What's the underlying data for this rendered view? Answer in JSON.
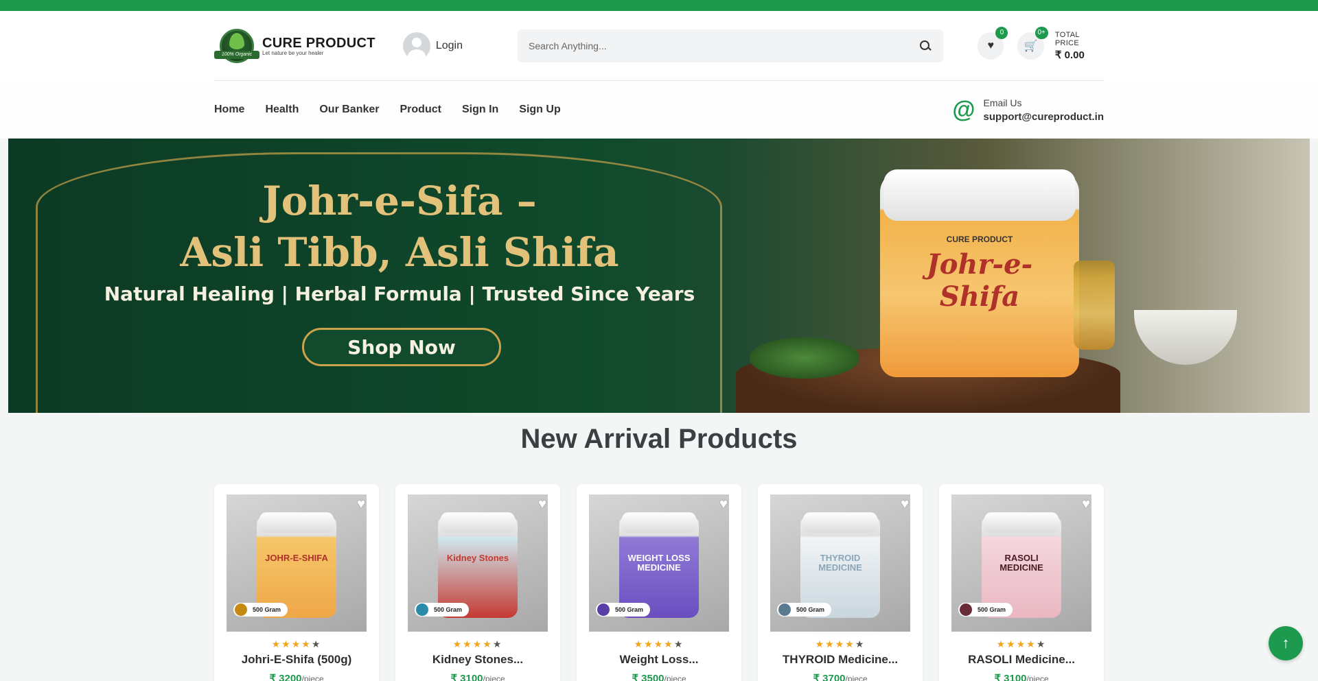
{
  "colors": {
    "brand": "#1d9a4d",
    "star": "#f0a51a"
  },
  "header": {
    "brand": "CURE PRODUCT",
    "tagline": "Let nature be your healer",
    "badge_text": "100% Organic",
    "login_label": "Login",
    "search_placeholder": "Search Anything...",
    "wishlist_count": "0",
    "cart_count": "0+",
    "total_label": "TOTAL PRICE",
    "total_value": "₹ 0.00"
  },
  "nav": {
    "items": [
      "Home",
      "Health",
      "Our Banker",
      "Product",
      "Sign In",
      "Sign Up"
    ],
    "email_label": "Email Us",
    "email_value": "support@cureproduct.in"
  },
  "banner": {
    "title_line1": "Johr-e-Sifa –",
    "title_line2": "Asli Tibb, Asli Shifa",
    "subtitle": "Natural Healing | Herbal Formula | Trusted Since Years",
    "cta": "Shop Now",
    "jar_brand": "CURE PRODUCT",
    "jar_title": "Johr-e-Shifa"
  },
  "section": {
    "title": "New Arrival Products"
  },
  "products": [
    {
      "name": "Johri-E-Shifa (500g)",
      "price": "₹ 3200",
      "unit": "/piece",
      "weight": "500 Gram",
      "label": "JOHR-E-SHIFA",
      "rating": 4,
      "label_color": "#f5c76a",
      "label_color2": "#efa748",
      "text_color": "#b0302a",
      "dot_color": "#c58a12"
    },
    {
      "name": "Kidney Stones...",
      "price": "₹ 3100",
      "unit": "/piece",
      "weight": "500 Gram",
      "label": "Kidney Stones",
      "rating": 4,
      "label_color": "#cfe7ee",
      "label_color2": "#c43a32",
      "text_color": "#c43a32",
      "dot_color": "#2a8aa8"
    },
    {
      "name": "Weight Loss...",
      "price": "₹ 3500",
      "unit": "/piece",
      "weight": "500 Gram",
      "label": "WEIGHT LOSS MEDICINE",
      "rating": 4,
      "label_color": "#8f7ad6",
      "label_color2": "#6a4ec0",
      "text_color": "#ffffff",
      "dot_color": "#5a3ea8"
    },
    {
      "name": "THYROID Medicine...",
      "price": "₹ 3700",
      "unit": "/piece",
      "weight": "500 Gram",
      "label": "THYROID MEDICINE",
      "rating": 4,
      "label_color": "#f1f4f6",
      "label_color2": "#c9d6de",
      "text_color": "#8aa6b8",
      "dot_color": "#5a7a90"
    },
    {
      "name": "RASOLI Medicine...",
      "price": "₹ 3100",
      "unit": "/piece",
      "weight": "500 Gram",
      "label": "RASOLI MEDICINE",
      "rating": 4,
      "label_color": "#f4d6dc",
      "label_color2": "#e9b7c2",
      "text_color": "#4a1a22",
      "dot_color": "#6a2a38"
    }
  ]
}
